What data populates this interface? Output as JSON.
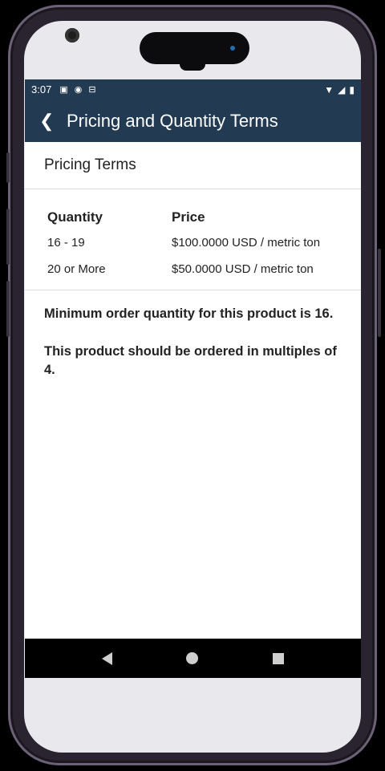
{
  "status_bar": {
    "time": "3:07",
    "left_icons": [
      "notification-a-icon",
      "cast-icon",
      "sim-icon"
    ],
    "right_icons": [
      "wifi-icon",
      "signal-icon",
      "battery-icon"
    ]
  },
  "app_bar": {
    "title": "Pricing and Quantity Terms"
  },
  "section": {
    "title": "Pricing Terms"
  },
  "table": {
    "headers": [
      "Quantity",
      "Price"
    ],
    "rows": [
      {
        "quantity": "16 - 19",
        "price": "$100.0000 USD / metric ton"
      },
      {
        "quantity": "20 or More",
        "price": "$50.0000 USD / metric ton"
      }
    ]
  },
  "notes": [
    "Minimum order quantity for this product is 16.",
    "This product should be ordered in multiples of 4."
  ],
  "colors": {
    "header_bg": "#223a52",
    "frame": "#2a2430"
  }
}
